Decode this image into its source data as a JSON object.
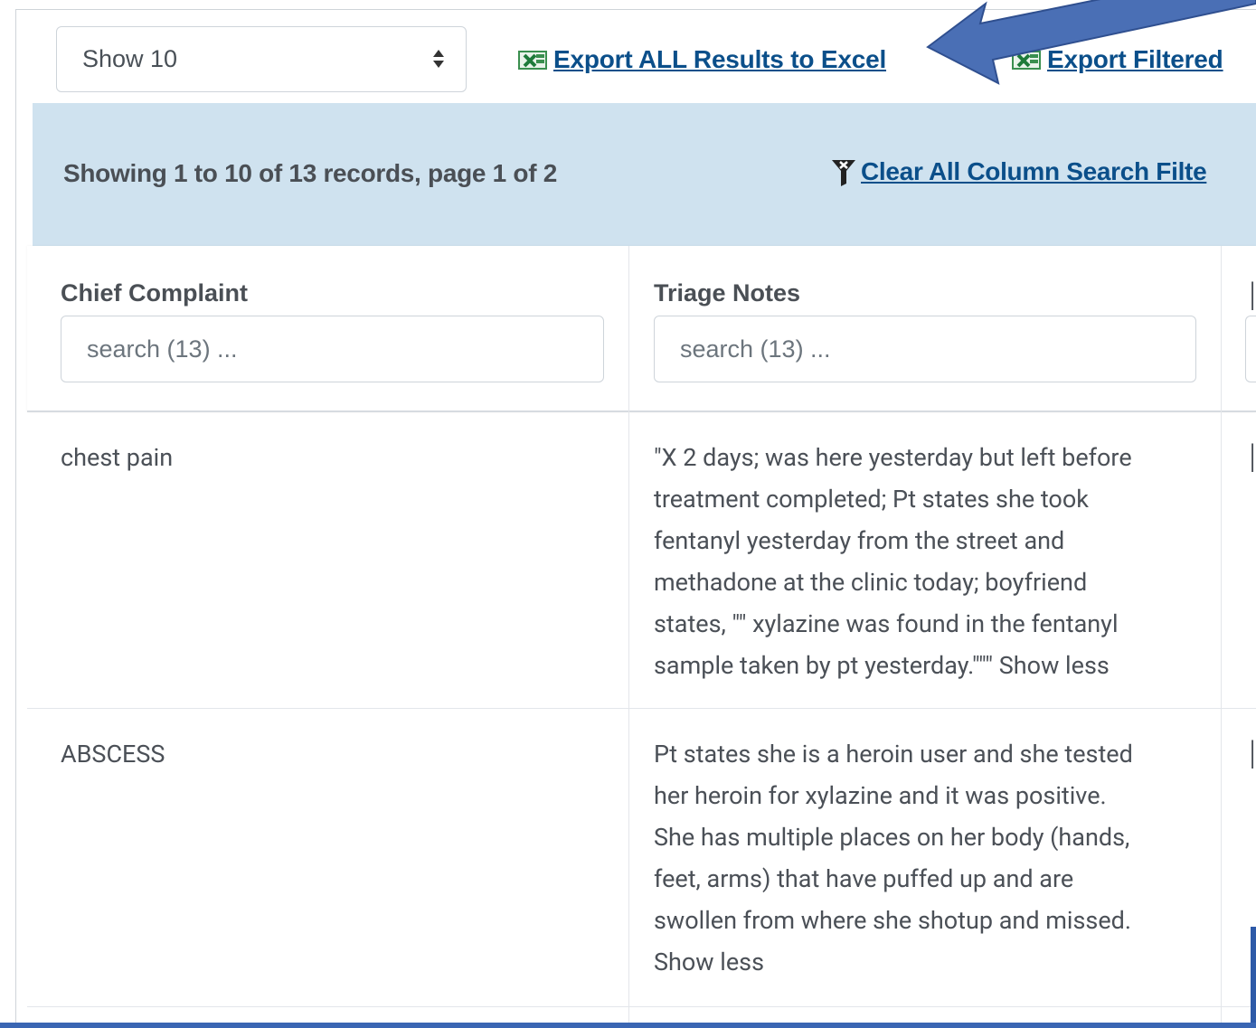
{
  "toolbar": {
    "page_size_select": "Show 10",
    "export_all_label": "Export ALL Results to Excel",
    "export_filtered_label": "Export Filtered"
  },
  "info": {
    "records_text": "Showing 1 to 10 of 13 records, page 1 of 2",
    "clear_filters_label": "Clear All Column Search Filte"
  },
  "table": {
    "columns": [
      {
        "label": "Chief Complaint",
        "search_placeholder": "search (13) ..."
      },
      {
        "label": "Triage Notes",
        "search_placeholder": "search (13) ..."
      }
    ],
    "rows": [
      {
        "chief_complaint": "chest pain",
        "triage_notes": "\"X 2 days; was here yesterday but left before\ntreatment completed; Pt states she took\nfentanyl yesterday from the street and\nmethadone at the clinic today; boyfriend\nstates, \"\" xylazine was found in the fentanyl\nsample taken by pt yesterday.\"\"\" Show less"
      },
      {
        "chief_complaint": "ABSCESS",
        "triage_notes": "Pt states she is a heroin user and she tested\nher heroin for xylazine and it was positive.\nShe has multiple places on her body (hands,\nfeet, arms) that have puffed up and are\nswollen from where she shotup and missed.\nShow less"
      }
    ]
  },
  "colors": {
    "link": "#0b4f8a",
    "band": "#cfe2ef",
    "annotation_arrow": "#4a6fb5",
    "excel_green": "#1e7a3a"
  },
  "icons": [
    "excel-icon",
    "filter-clear-icon",
    "sort-arrows-icon",
    "annotation-arrow"
  ]
}
